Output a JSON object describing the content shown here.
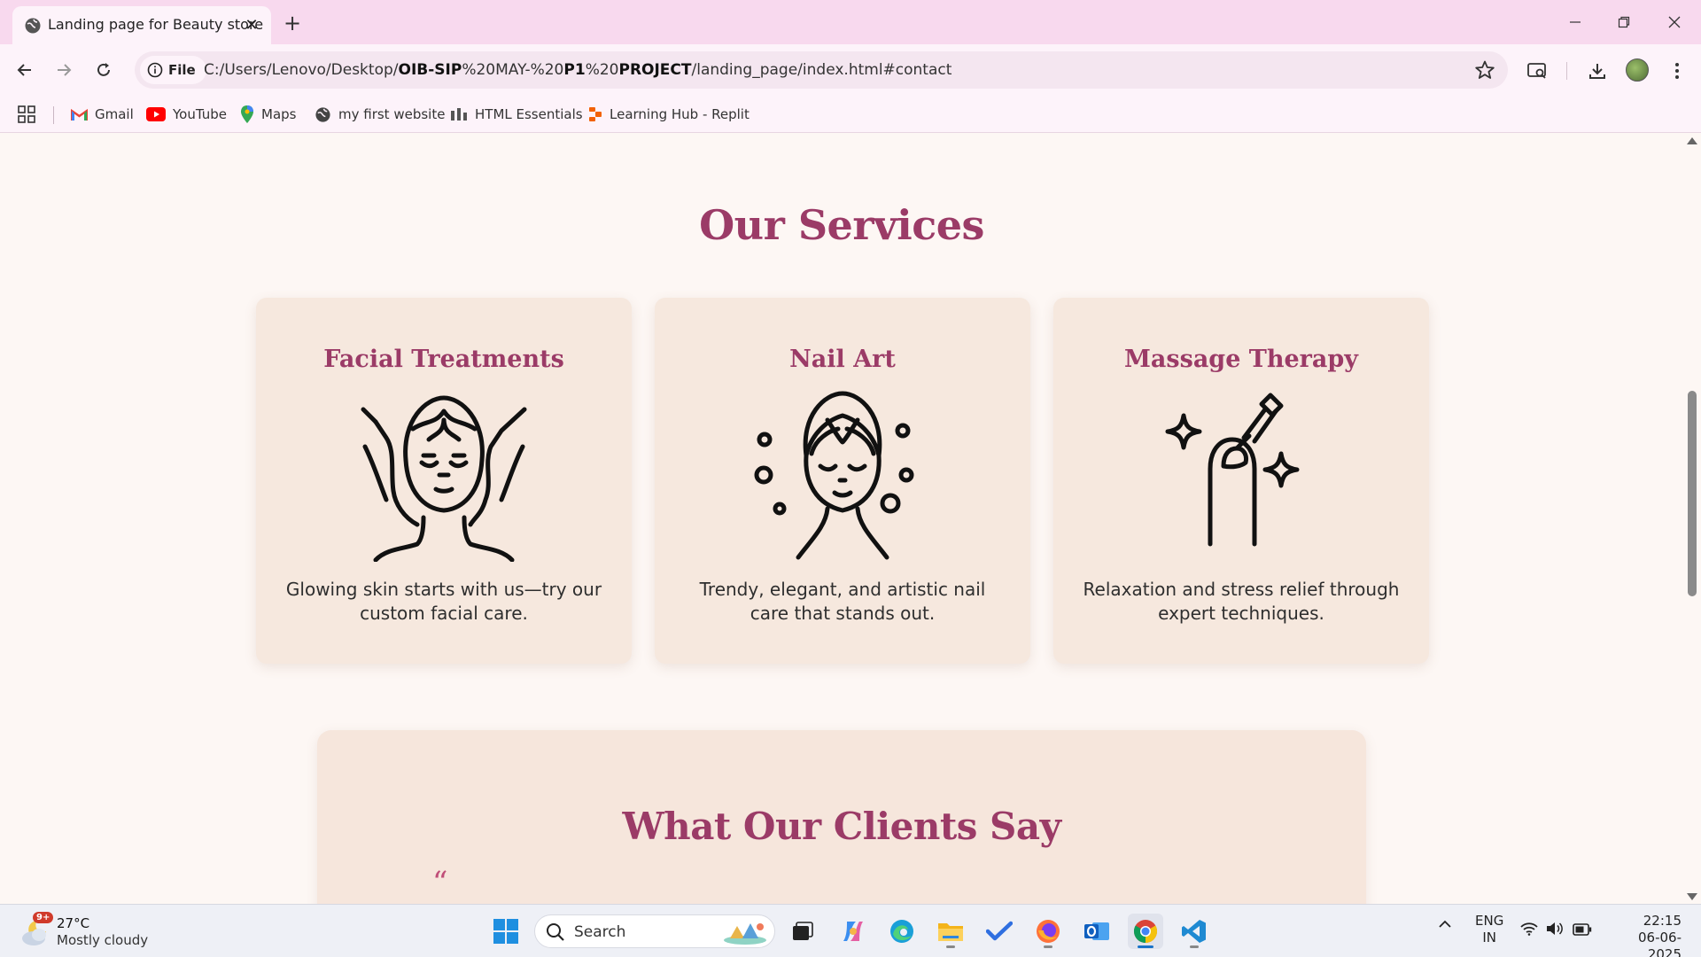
{
  "browser": {
    "tab_title": "Landing page for Beauty store",
    "site_chip": "File",
    "url_parts": [
      {
        "text": "C:/Users/Lenovo/Desktop/",
        "bold": false
      },
      {
        "text": "OIB-SIP",
        "bold": true
      },
      {
        "text": "%20MAY-%20",
        "bold": false
      },
      {
        "text": "P1",
        "bold": true
      },
      {
        "text": "%20",
        "bold": false
      },
      {
        "text": "PROJECT",
        "bold": true
      },
      {
        "text": "/landing_page/index.html#contact",
        "bold": false
      }
    ],
    "bookmarks": [
      {
        "label": "Gmail",
        "icon": "gmail-icon"
      },
      {
        "label": "YouTube",
        "icon": "youtube-icon"
      },
      {
        "label": "Maps",
        "icon": "maps-icon"
      },
      {
        "label": "my first website",
        "icon": "globe-icon"
      },
      {
        "label": "HTML Essentials",
        "icon": "bookmark-site-icon"
      },
      {
        "label": "Learning Hub - Replit",
        "icon": "replit-icon"
      }
    ]
  },
  "page": {
    "services_title": "Our Services",
    "services": [
      {
        "title": "Facial Treatments",
        "description": "Glowing skin starts with us—try our custom facial care.",
        "icon": "facial-treatment-icon"
      },
      {
        "title": "Nail Art",
        "description": "Trendy, elegant, and artistic nail care that stands out.",
        "icon": "face-care-icon"
      },
      {
        "title": "Massage Therapy",
        "description": "Relaxation and stress relief through expert techniques.",
        "icon": "nail-polish-icon"
      }
    ],
    "testimonials_title": "What Our Clients Say",
    "quote_mark": "“"
  },
  "taskbar": {
    "weather_badge": "9+",
    "weather_temp": "27°C",
    "weather_desc": "Mostly cloudy",
    "search_placeholder": "Search",
    "lang_line1": "ENG",
    "lang_line2": "IN",
    "time": "22:15",
    "date": "06-06-2025"
  },
  "colors": {
    "heading": "#9b3b67",
    "card_bg": "#f6e8de",
    "page_bg": "#fdf7f4",
    "tabbar_bg": "#f8d9ee"
  }
}
